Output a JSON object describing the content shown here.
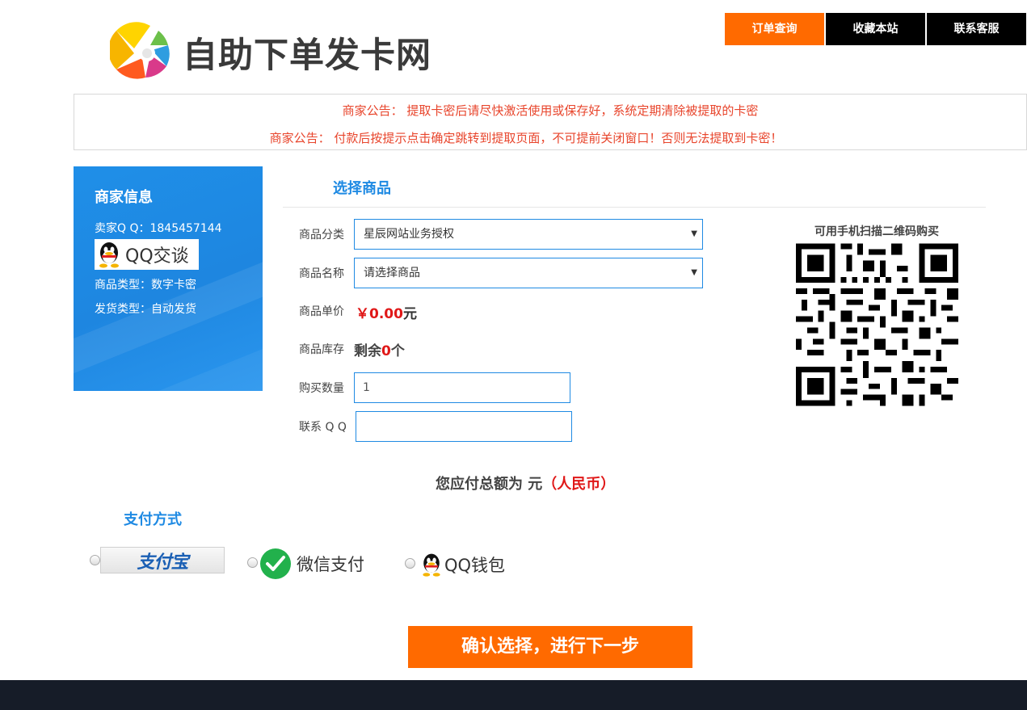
{
  "header": {
    "site_title": "自助下单发卡网",
    "nav": [
      {
        "label": "订单查询",
        "active": true
      },
      {
        "label": "收藏本站",
        "active": false
      },
      {
        "label": "联系客服",
        "active": false
      }
    ]
  },
  "notices": [
    "商家公告： 提取卡密后请尽快激活使用或保存好，系统定期清除被提取的卡密",
    "商家公告： 付款后按提示点击确定跳转到提取页面，不可提前关闭窗口！否则无法提取到卡密！"
  ],
  "merchant": {
    "title": "商家信息",
    "seller_qq": "卖家Q Q：1845457144",
    "qq_chat_label": "QQ交谈",
    "goods_type": "商品类型：数字卡密",
    "delivery_type": "发货类型：自动发货"
  },
  "goods": {
    "section_title": "选择商品",
    "category_label": "商品分类",
    "category_value": "星辰网站业务授权",
    "name_label": "商品名称",
    "name_value": "请选择商品",
    "price_label": "商品单价",
    "price_value": "￥0.00",
    "price_unit": "元",
    "stock_label": "商品库存",
    "stock_prefix": "剩余",
    "stock_count": "0",
    "stock_suffix": "个",
    "quantity_label": "购买数量",
    "quantity_value": "1",
    "contact_label": "联系 Q Q",
    "contact_value": ""
  },
  "qr": {
    "label": "可用手机扫描二维码购买"
  },
  "total": {
    "text": "您应付总额为 元",
    "currency": "（人民币）"
  },
  "payment": {
    "title": "支付方式",
    "alipay_label": "支付宝",
    "wechat_label": "微信支付",
    "qqwallet_label": "QQ钱包"
  },
  "confirm_label": "确认选择，进行下一步",
  "colors": {
    "accent_orange": "#ff6a00",
    "accent_blue": "#1f8ae3",
    "alert_red": "#e01818",
    "footer": "#161c28"
  }
}
